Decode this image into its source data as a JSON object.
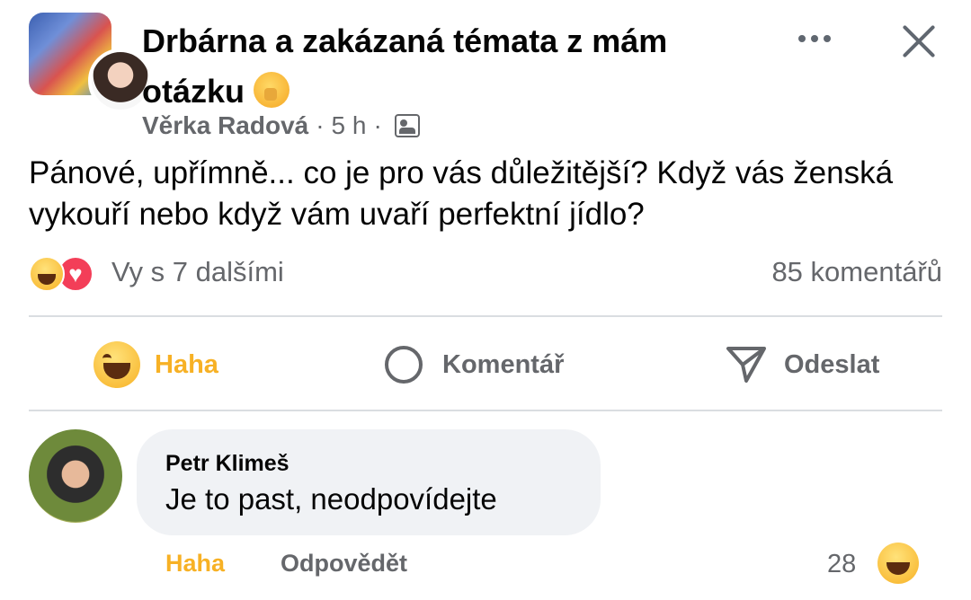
{
  "post": {
    "group_title": "Drbárna a zakázaná témata z mám otázku",
    "group_emoji": "shushing-face",
    "author": "Věrka Radová",
    "separator": "·",
    "time": "5 h",
    "audience_icon": "group-members-icon",
    "text": "Pánové, upřímně... co je pro vás důležitější? Když vás ženská vykouří nebo když vám uvaří perfektní jídlo?"
  },
  "reactions": {
    "icons": [
      "haha",
      "love"
    ],
    "summary": "Vy s 7 dalšími",
    "comments": "85 komentářů"
  },
  "actions": {
    "haha": "Haha",
    "comment": "Komentář",
    "send": "Odeslat"
  },
  "comment": {
    "author": "Petr Klimeš",
    "text": "Je to past, neodpovídejte",
    "haha": "Haha",
    "reply": "Odpovědět",
    "reaction_count": "28",
    "reaction_icon": "haha"
  },
  "colors": {
    "haha_accent": "#f7b125",
    "love_accent": "#f33e58",
    "secondary_text": "#65676b",
    "bubble_bg": "#f0f2f5"
  }
}
